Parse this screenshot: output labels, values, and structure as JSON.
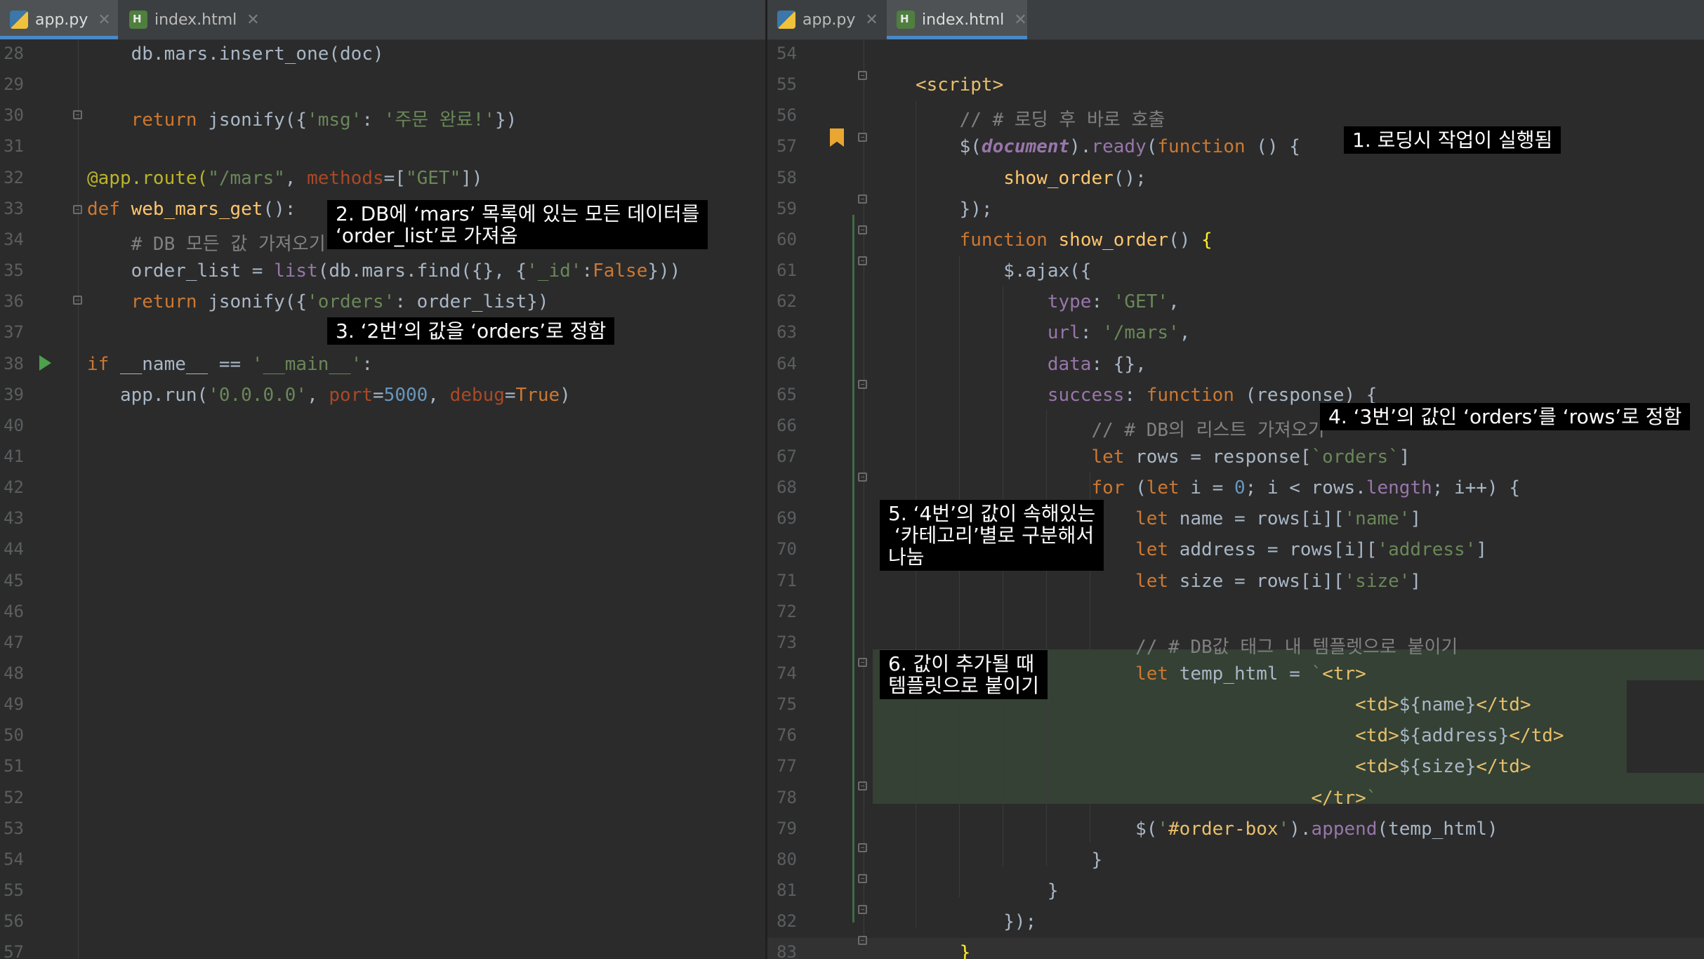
{
  "left_pane": {
    "tabs": [
      {
        "label": "app.py",
        "icon": "python-file-icon",
        "active": true
      },
      {
        "label": "index.html",
        "icon": "html-file-icon",
        "active": false
      }
    ],
    "close_glyph": "✕",
    "line_numbers": [
      "28",
      "29",
      "30",
      "31",
      "32",
      "33",
      "34",
      "35",
      "36",
      "37",
      "38",
      "39",
      "40",
      "41",
      "42",
      "43",
      "44",
      "45",
      "46",
      "47",
      "48",
      "49",
      "50",
      "51",
      "52",
      "53",
      "54",
      "55",
      "56",
      "57"
    ],
    "lines": [
      [
        {
          "t": "    db.mars.insert_one(doc)"
        }
      ],
      [],
      [
        {
          "t": "    "
        },
        {
          "t": "return ",
          "c": "kw"
        },
        {
          "t": "jsonify({"
        },
        {
          "t": "'msg'",
          "c": "str"
        },
        {
          "t": ": "
        },
        {
          "t": "'주문 완료!'",
          "c": "str"
        },
        {
          "t": "})"
        }
      ],
      [],
      [
        {
          "t": "@app.route(",
          "c": "dec"
        },
        {
          "t": "\"/mars\"",
          "c": "str"
        },
        {
          "t": ", "
        },
        {
          "t": "methods",
          "c": "prm"
        },
        {
          "t": "=["
        },
        {
          "t": "\"GET\"",
          "c": "str"
        },
        {
          "t": "])"
        }
      ],
      [
        {
          "t": "def ",
          "c": "kw"
        },
        {
          "t": "web_mars_get",
          "c": "fn"
        },
        {
          "t": "():"
        }
      ],
      [
        {
          "t": "    "
        },
        {
          "t": "# DB 모든 값 가져오기",
          "c": "cm"
        }
      ],
      [
        {
          "t": "    order_list = "
        },
        {
          "t": "list",
          "c": "prop"
        },
        {
          "t": "(db.mars.find({}, {"
        },
        {
          "t": "'_id'",
          "c": "str"
        },
        {
          "t": ":"
        },
        {
          "t": "False",
          "c": "kw"
        },
        {
          "t": "}))"
        }
      ],
      [
        {
          "t": "    "
        },
        {
          "t": "return ",
          "c": "kw"
        },
        {
          "t": "jsonify({"
        },
        {
          "t": "'orders'",
          "c": "str"
        },
        {
          "t": ": order_list})"
        }
      ],
      [],
      [
        {
          "t": "if ",
          "c": "kw"
        },
        {
          "t": "__name__ == "
        },
        {
          "t": "'__main__'",
          "c": "str"
        },
        {
          "t": ":"
        }
      ],
      [
        {
          "t": "   app.run("
        },
        {
          "t": "'0.0.0.0'",
          "c": "str"
        },
        {
          "t": ", "
        },
        {
          "t": "port",
          "c": "prm"
        },
        {
          "t": "="
        },
        {
          "t": "5000",
          "c": "num"
        },
        {
          "t": ", "
        },
        {
          "t": "debug",
          "c": "prm"
        },
        {
          "t": "="
        },
        {
          "t": "True",
          "c": "kw"
        },
        {
          "t": ")"
        }
      ],
      [],
      [],
      [],
      [],
      [],
      [],
      [],
      [],
      [],
      [],
      [],
      [],
      [],
      [],
      [],
      [],
      [],
      []
    ]
  },
  "right_pane": {
    "tabs": [
      {
        "label": "app.py",
        "icon": "python-file-icon",
        "active": false
      },
      {
        "label": "index.html",
        "icon": "html-file-icon",
        "active": true
      }
    ],
    "close_glyph": "✕",
    "line_numbers": [
      "54",
      "55",
      "56",
      "57",
      "58",
      "59",
      "60",
      "61",
      "62",
      "63",
      "64",
      "65",
      "66",
      "67",
      "68",
      "69",
      "70",
      "71",
      "72",
      "73",
      "74",
      "75",
      "76",
      "77",
      "78",
      "79",
      "80",
      "81",
      "82",
      "83"
    ],
    "lines": [
      [],
      [
        {
          "t": "<script>",
          "c": "tag"
        }
      ],
      [
        {
          "t": "    "
        },
        {
          "t": "// # 로딩 후 바로 호출",
          "c": "cm"
        }
      ],
      [
        {
          "t": "    $("
        },
        {
          "t": "document",
          "c": "doc"
        },
        {
          "t": ")."
        },
        {
          "t": "ready",
          "c": "prop"
        },
        {
          "t": "("
        },
        {
          "t": "function ",
          "c": "kw"
        },
        {
          "t": "() {"
        }
      ],
      [
        {
          "t": "        "
        },
        {
          "t": "show_order",
          "c": "fn"
        },
        {
          "t": "();"
        }
      ],
      [
        {
          "t": "    });"
        }
      ],
      [
        {
          "t": "    "
        },
        {
          "t": "function ",
          "c": "kw"
        },
        {
          "t": "show_order",
          "c": "fn"
        },
        {
          "t": "() "
        },
        {
          "t": "{",
          "c": "brace"
        }
      ],
      [
        {
          "t": "        $.ajax({"
        }
      ],
      [
        {
          "t": "            "
        },
        {
          "t": "type",
          "c": "prop"
        },
        {
          "t": ": "
        },
        {
          "t": "'GET'",
          "c": "str"
        },
        {
          "t": ","
        }
      ],
      [
        {
          "t": "            "
        },
        {
          "t": "url",
          "c": "prop"
        },
        {
          "t": ": "
        },
        {
          "t": "'/mars'",
          "c": "str"
        },
        {
          "t": ","
        }
      ],
      [
        {
          "t": "            "
        },
        {
          "t": "data",
          "c": "prop"
        },
        {
          "t": ": {},"
        }
      ],
      [
        {
          "t": "            "
        },
        {
          "t": "success",
          "c": "prop"
        },
        {
          "t": ": "
        },
        {
          "t": "function ",
          "c": "kw"
        },
        {
          "t": "(response) {"
        }
      ],
      [
        {
          "t": "                "
        },
        {
          "t": "// # DB의 리스트 가져오기",
          "c": "cm"
        }
      ],
      [
        {
          "t": "                "
        },
        {
          "t": "let ",
          "c": "kw"
        },
        {
          "t": "rows = response["
        },
        {
          "t": "`orders`",
          "c": "str"
        },
        {
          "t": "]"
        }
      ],
      [
        {
          "t": "                "
        },
        {
          "t": "for ",
          "c": "kw"
        },
        {
          "t": "("
        },
        {
          "t": "let ",
          "c": "kw"
        },
        {
          "t": "i = "
        },
        {
          "t": "0",
          "c": "num"
        },
        {
          "t": "; i < rows."
        },
        {
          "t": "length",
          "c": "prop"
        },
        {
          "t": "; i++) {"
        }
      ],
      [
        {
          "t": "                    "
        },
        {
          "t": "let ",
          "c": "kw"
        },
        {
          "t": "name = rows[i]["
        },
        {
          "t": "'name'",
          "c": "str"
        },
        {
          "t": "]"
        }
      ],
      [
        {
          "t": "                    "
        },
        {
          "t": "let ",
          "c": "kw"
        },
        {
          "t": "address = rows[i]["
        },
        {
          "t": "'address'",
          "c": "str"
        },
        {
          "t": "]"
        }
      ],
      [
        {
          "t": "                    "
        },
        {
          "t": "let ",
          "c": "kw"
        },
        {
          "t": "size = rows[i]["
        },
        {
          "t": "'size'",
          "c": "str"
        },
        {
          "t": "]"
        }
      ],
      [],
      [
        {
          "t": "                    "
        },
        {
          "t": "// # DB값 태그 내 템플렛으로 붙이기",
          "c": "cm"
        }
      ],
      [
        {
          "t": "                    "
        },
        {
          "t": "let ",
          "c": "kw"
        },
        {
          "t": "temp_html = "
        },
        {
          "t": "`",
          "c": "bt"
        },
        {
          "t": "<tr>",
          "c": "tag"
        }
      ],
      [
        {
          "t": "                                        "
        },
        {
          "t": "<td>",
          "c": "tag"
        },
        {
          "t": "${name}"
        },
        {
          "t": "</td>",
          "c": "tag"
        }
      ],
      [
        {
          "t": "                                        "
        },
        {
          "t": "<td>",
          "c": "tag"
        },
        {
          "t": "${address}"
        },
        {
          "t": "</td>",
          "c": "tag"
        }
      ],
      [
        {
          "t": "                                        "
        },
        {
          "t": "<td>",
          "c": "tag"
        },
        {
          "t": "${size}"
        },
        {
          "t": "</td>",
          "c": "tag"
        }
      ],
      [
        {
          "t": "                                    "
        },
        {
          "t": "</tr>",
          "c": "tag"
        },
        {
          "t": "`",
          "c": "bt"
        }
      ],
      [
        {
          "t": "                    $("
        },
        {
          "t": "'",
          "c": "str"
        },
        {
          "t": "#order-box",
          "c": "tag"
        },
        {
          "t": "'",
          "c": "str"
        },
        {
          "t": ")."
        },
        {
          "t": "append",
          "c": "prop"
        },
        {
          "t": "(temp_html)"
        }
      ],
      [
        {
          "t": "                }"
        }
      ],
      [
        {
          "t": "            }"
        }
      ],
      [
        {
          "t": "        });"
        }
      ],
      [
        {
          "t": "    "
        },
        {
          "t": "}",
          "c": "brace"
        }
      ]
    ]
  },
  "annotations": [
    {
      "text": "1. 로딩시 작업이 실행됨"
    },
    {
      "text": "2. DB에 ‘mars’ 목록에 있는 모든 데이터를\n‘order_list’로 가져옴"
    },
    {
      "text": "3. ‘2번’의 값을 ‘orders’로 정함"
    },
    {
      "text": "4. ‘3번’의 값인 ‘orders’를 ‘rows’로 정함"
    },
    {
      "text": "5. ‘4번’의 값이 속해있는\n ‘카테고리’별로 구분해서\n나눔"
    },
    {
      "text": "6. 값이 추가될 때\n템플릿으로 붙이기"
    }
  ],
  "colors": {
    "background": "#2b2b2b",
    "keyword": "#cc7832",
    "string": "#6a8759",
    "number": "#6897bb",
    "comment": "#808080",
    "function": "#ffc66d",
    "decorator": "#bbb529",
    "tag": "#e8bf6a",
    "accent": "#4a88c7"
  }
}
